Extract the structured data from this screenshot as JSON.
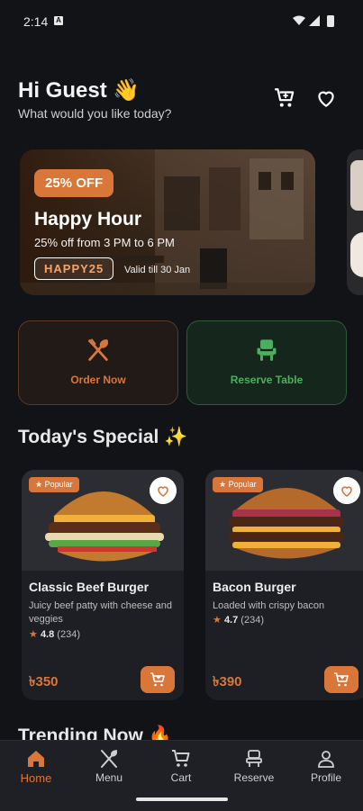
{
  "status": {
    "time": "2:14",
    "notif": "A"
  },
  "header": {
    "greeting": "Hi Guest 👋",
    "subtitle": "What would you like today?",
    "cart_icon": "cart-icon",
    "heart_icon": "heart-icon"
  },
  "banner": {
    "badge": "25% OFF",
    "title": "Happy Hour",
    "subtitle": "25% off from 3 PM to 6 PM",
    "code": "HAPPY25",
    "valid": "Valid till 30 Jan"
  },
  "actions": [
    {
      "label": "Order Now",
      "icon": "fork-spoon-icon",
      "color": "#d9773b"
    },
    {
      "label": "Reserve Table",
      "icon": "chair-icon",
      "color": "#4caf60"
    }
  ],
  "specials": {
    "title": "Today's Special",
    "items": [
      {
        "badge": "Popular",
        "name": "Classic Beef Burger",
        "desc": "Juicy beef patty with cheese and veggies",
        "rating": "4.8",
        "reviews": "(234)",
        "price": "৳350"
      },
      {
        "badge": "Popular",
        "name": "Bacon Burger",
        "desc": "Loaded with crispy bacon",
        "rating": "4.7",
        "reviews": "(234)",
        "price": "৳390"
      }
    ]
  },
  "trending": {
    "title": "Trending Now"
  },
  "nav": [
    {
      "label": "Home",
      "icon": "home-icon"
    },
    {
      "label": "Menu",
      "icon": "fork-knife-icon"
    },
    {
      "label": "Cart",
      "icon": "cart-icon"
    },
    {
      "label": "Reserve",
      "icon": "chair-icon"
    },
    {
      "label": "Profile",
      "icon": "user-icon"
    }
  ],
  "colors": {
    "accent": "#d9773b",
    "green": "#4caf60",
    "background": "#111317"
  }
}
